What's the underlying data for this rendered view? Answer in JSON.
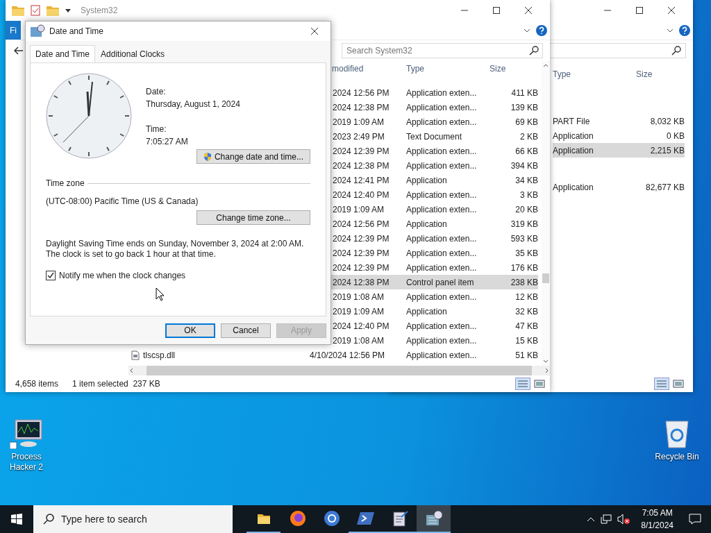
{
  "back_window": {
    "columns": [
      "Type",
      "Size"
    ],
    "rows": [
      {
        "type": "PART File",
        "size": "8,032 KB",
        "selected": false
      },
      {
        "type": "Application",
        "size": "0 KB",
        "selected": false
      },
      {
        "type": "Application",
        "size": "2,215 KB",
        "selected": true
      },
      {
        "type": "Application",
        "size": "82,677 KB",
        "selected": false
      }
    ]
  },
  "explorer": {
    "title": "System32",
    "file_tab": "Fi",
    "search": {
      "placeholder": "Search System32"
    },
    "columns": [
      "modified",
      "Type",
      "Size"
    ],
    "rows": [
      {
        "date": "2024 12:56 PM",
        "type": "Application exten...",
        "size": "411 KB",
        "selected": false
      },
      {
        "date": "2024 12:38 PM",
        "type": "Application exten...",
        "size": "139 KB",
        "selected": false
      },
      {
        "date": "2019 1:09 AM",
        "type": "Application exten...",
        "size": "69 KB",
        "selected": false
      },
      {
        "date": "2023 2:49 PM",
        "type": "Text Document",
        "size": "2 KB",
        "selected": false
      },
      {
        "date": "2024 12:39 PM",
        "type": "Application exten...",
        "size": "66 KB",
        "selected": false
      },
      {
        "date": "2024 12:38 PM",
        "type": "Application exten...",
        "size": "394 KB",
        "selected": false
      },
      {
        "date": "2024 12:41 PM",
        "type": "Application",
        "size": "34 KB",
        "selected": false
      },
      {
        "date": "2024 12:40 PM",
        "type": "Application exten...",
        "size": "3 KB",
        "selected": false
      },
      {
        "date": "2019 1:09 AM",
        "type": "Application exten...",
        "size": "20 KB",
        "selected": false
      },
      {
        "date": "2024 12:56 PM",
        "type": "Application",
        "size": "319 KB",
        "selected": false
      },
      {
        "date": "2024 12:39 PM",
        "type": "Application exten...",
        "size": "593 KB",
        "selected": false
      },
      {
        "date": "2024 12:39 PM",
        "type": "Application exten...",
        "size": "35 KB",
        "selected": false
      },
      {
        "date": "2024 12:39 PM",
        "type": "Application exten...",
        "size": "176 KB",
        "selected": false
      },
      {
        "date": "2024 12:38 PM",
        "type": "Control panel item",
        "size": "238 KB",
        "selected": true
      },
      {
        "date": "2019 1:08 AM",
        "type": "Application exten...",
        "size": "12 KB",
        "selected": false
      },
      {
        "date": "2019 1:09 AM",
        "type": "Application",
        "size": "32 KB",
        "selected": false
      },
      {
        "date": "2024 12:40 PM",
        "type": "Application exten...",
        "size": "47 KB",
        "selected": false
      },
      {
        "date": "2019 1:08 AM",
        "type": "Application exten...",
        "size": "15 KB",
        "selected": false
      },
      {
        "name": "tlscsp.dll",
        "date": "4/10/2024 12:56 PM",
        "type": "Application exten...",
        "size": "51 KB",
        "selected": false
      }
    ],
    "status_bar": {
      "count": "4,658 items",
      "selection": "1 item selected  237 KB"
    }
  },
  "dialog": {
    "title": "Date and Time",
    "tabs": [
      {
        "label": "Date and Time",
        "selected": true
      },
      {
        "label": "Additional Clocks",
        "selected": false
      }
    ],
    "date_label": "Date:",
    "date": "Thursday, August 1, 2024",
    "time_label": "Time:",
    "time": "7:05:27 AM",
    "change_datetime_button": "Change date and time...",
    "time_zone_heading": "Time zone",
    "time_zone": "(UTC-08:00) Pacific Time (US & Canada)",
    "change_zone_button": "Change time zone...",
    "dst_note": "Daylight Saving Time ends on Sunday, November 3, 2024 at 2:00 AM. The clock is set to go back 1 hour at that time.",
    "notify": {
      "label": "Notify me when the clock changes",
      "checked": true
    },
    "buttons": [
      {
        "label": "OK",
        "disabled": false,
        "default": true
      },
      {
        "label": "Cancel",
        "disabled": false,
        "default": false
      },
      {
        "label": "Apply",
        "disabled": true,
        "default": false
      }
    ]
  },
  "desktop_icons": [
    {
      "label": "Process Hacker 2",
      "kind": "monitor"
    },
    {
      "label": "Recycle Bin",
      "kind": "recycle"
    }
  ],
  "taskbar": {
    "search": {
      "placeholder": "Type here to search"
    },
    "apps": [
      {
        "kind": "folder",
        "running": true,
        "active": false
      },
      {
        "kind": "firefox",
        "running": false,
        "active": false
      },
      {
        "kind": "chrome",
        "running": false,
        "active": false
      },
      {
        "kind": "terminal",
        "running": true,
        "active": false
      },
      {
        "kind": "notepad",
        "running": true,
        "active": false
      },
      {
        "kind": "datetime",
        "running": true,
        "active": true
      }
    ],
    "time": "7:05 AM",
    "date": "8/1/2024"
  }
}
